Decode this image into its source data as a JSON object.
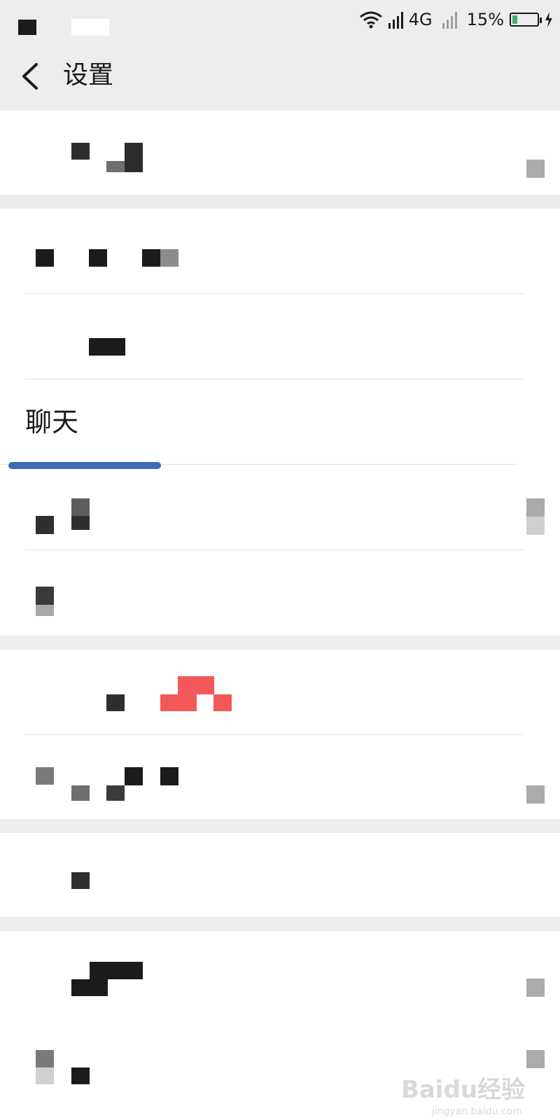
{
  "status_bar": {
    "network_label": "4G",
    "battery_text": "15%",
    "icons": [
      "wifi-icon",
      "signal-icon",
      "signal-icon",
      "battery-icon",
      "charging-icon"
    ]
  },
  "header": {
    "title": "设置",
    "back_icon": "back-icon"
  },
  "menu": {
    "chat_label": "聊天"
  },
  "watermark": {
    "brand": "Bai",
    "brand_suffix": "du经验",
    "url": "jingyan.baidu.com"
  },
  "colors": {
    "background": "#ededed",
    "surface": "#ffffff",
    "highlight": "#3e6bb7",
    "badge": "#f25858"
  }
}
